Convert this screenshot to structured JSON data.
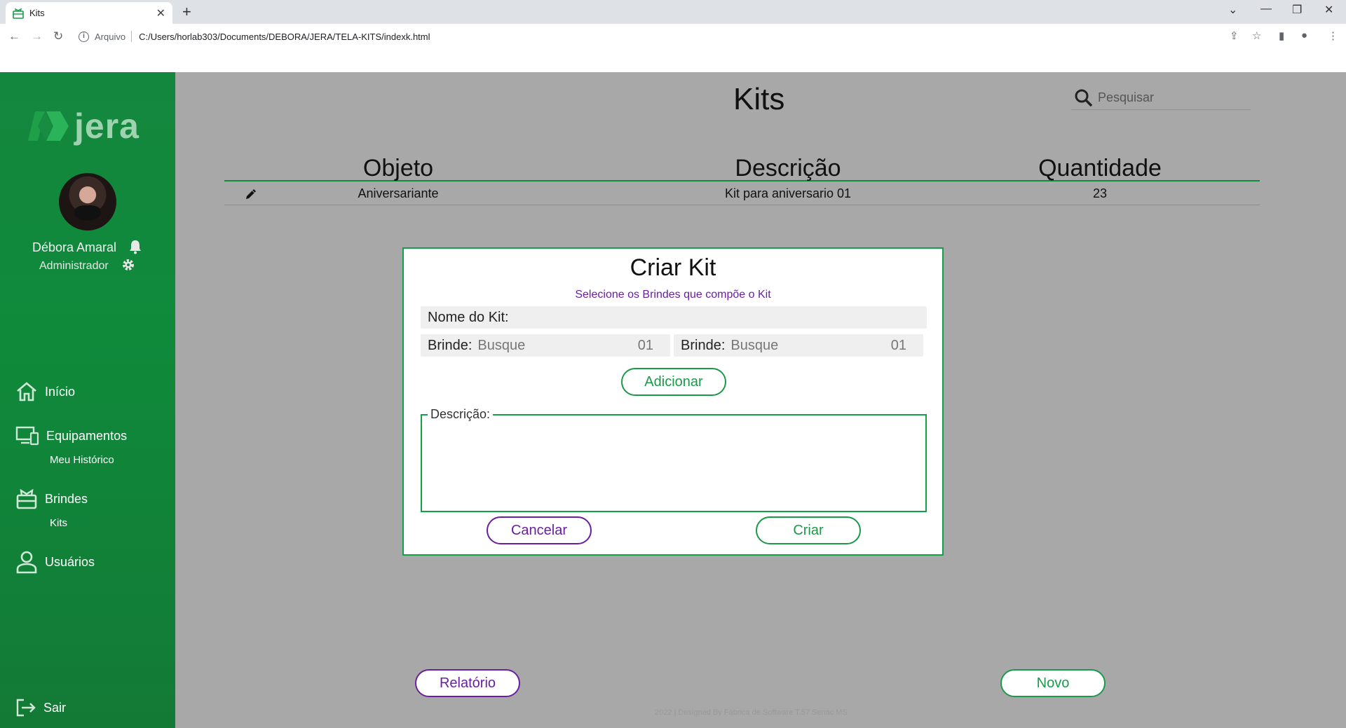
{
  "browser": {
    "tab_title": "Kits",
    "address_label": "Arquivo",
    "url": "C:/Users/horlab303/Documents/DEBORA/JERA/TELA-KITS/indexk.html"
  },
  "sidebar": {
    "logo_text": "jera",
    "user_name": "Débora Amaral",
    "user_role": "Administrador",
    "nav": {
      "inicio": "Início",
      "equipamentos": "Equipamentos",
      "meu_historico": "Meu Histórico",
      "brindes": "Brindes",
      "kits": "Kits",
      "usuarios": "Usuários",
      "sair": "Sair"
    }
  },
  "main": {
    "title": "Kits",
    "search_placeholder": "Pesquisar",
    "table": {
      "headers": [
        "Objeto",
        "Descrição",
        "Quantidade"
      ],
      "rows": [
        {
          "objeto": "Aniversariante",
          "descricao": "Kit para aniversario 01",
          "quantidade": "23"
        }
      ]
    },
    "relatorio_label": "Relatório",
    "novo_label": "Novo",
    "footer": "2022 | Designed By Fábrica de Software T.57 Senac MS"
  },
  "modal": {
    "title": "Criar Kit",
    "subtitle": "Selecione os Brindes que compõe o Kit",
    "nome_label": "Nome do Kit:",
    "brinde1": {
      "label": "Brinde:",
      "placeholder": "Busque",
      "qty": "01"
    },
    "brinde2": {
      "label": "Brinde:",
      "placeholder": "Busque",
      "qty": "01"
    },
    "adicionar_label": "Adicionar",
    "descricao_label": "Descrição:",
    "cancelar_label": "Cancelar",
    "criar_label": "Criar"
  },
  "colors": {
    "brand_green": "#14873e",
    "accent_purple": "#6a1fa0",
    "overlay_gray": "#a8a8a8"
  }
}
